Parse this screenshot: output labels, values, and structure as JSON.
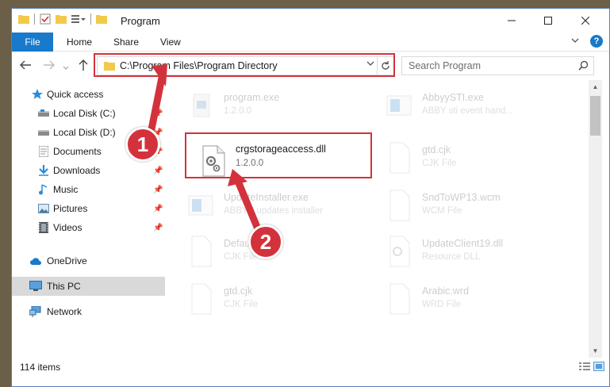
{
  "window": {
    "title": "Program",
    "minimize_icon": "minimize-icon",
    "maximize_icon": "maximize-icon",
    "close_icon": "close-icon"
  },
  "ribbon": {
    "tabs": [
      "File",
      "Home",
      "Share",
      "View"
    ],
    "help": "?"
  },
  "address": {
    "path": "C:\\Program Files\\Program Directory"
  },
  "search": {
    "placeholder": "Search Program"
  },
  "sidebar": {
    "items": [
      {
        "label": "Quick access",
        "icon": "star-icon",
        "pinned": false
      },
      {
        "label": "Local Disk (C:)",
        "icon": "drive-icon",
        "pinned": true
      },
      {
        "label": "Local Disk (D:)",
        "icon": "drive-icon",
        "pinned": true
      },
      {
        "label": "Documents",
        "icon": "documents-icon",
        "pinned": true
      },
      {
        "label": "Downloads",
        "icon": "downloads-icon",
        "pinned": true
      },
      {
        "label": "Music",
        "icon": "music-icon",
        "pinned": true
      },
      {
        "label": "Pictures",
        "icon": "pictures-icon",
        "pinned": true
      },
      {
        "label": "Videos",
        "icon": "videos-icon",
        "pinned": true
      },
      {
        "label": "OneDrive",
        "icon": "cloud-icon",
        "pinned": false
      },
      {
        "label": "This PC",
        "icon": "computer-icon",
        "pinned": false
      },
      {
        "label": "Network",
        "icon": "network-icon",
        "pinned": false
      }
    ]
  },
  "files": [
    {
      "name": "program.exe",
      "meta": "1.2.0.0"
    },
    {
      "name": "AbbyySTI.exe",
      "meta": "ABBY sti event hand..."
    },
    {
      "name": "crgstorageaccess.dll",
      "meta": "1.2.0.0"
    },
    {
      "name": "gtd.cjk",
      "meta": "CJK File"
    },
    {
      "name": "UpdateInstaller.exe",
      "meta": "ABBYY updates installer"
    },
    {
      "name": "SndToWP13.wcm",
      "meta": "WCM File"
    },
    {
      "name": "Default.cjk",
      "meta": "CJK File"
    },
    {
      "name": "UpdateClient19.dll",
      "meta": "Resource DLL"
    },
    {
      "name": "gtd.cjk",
      "meta": "CJK File"
    },
    {
      "name": "Arabic.wrd",
      "meta": "WRD File"
    }
  ],
  "status": {
    "count": "114 items"
  },
  "callouts": [
    "1",
    "2"
  ],
  "colors": {
    "accent": "#1979ca",
    "highlight": "#d3323c"
  }
}
